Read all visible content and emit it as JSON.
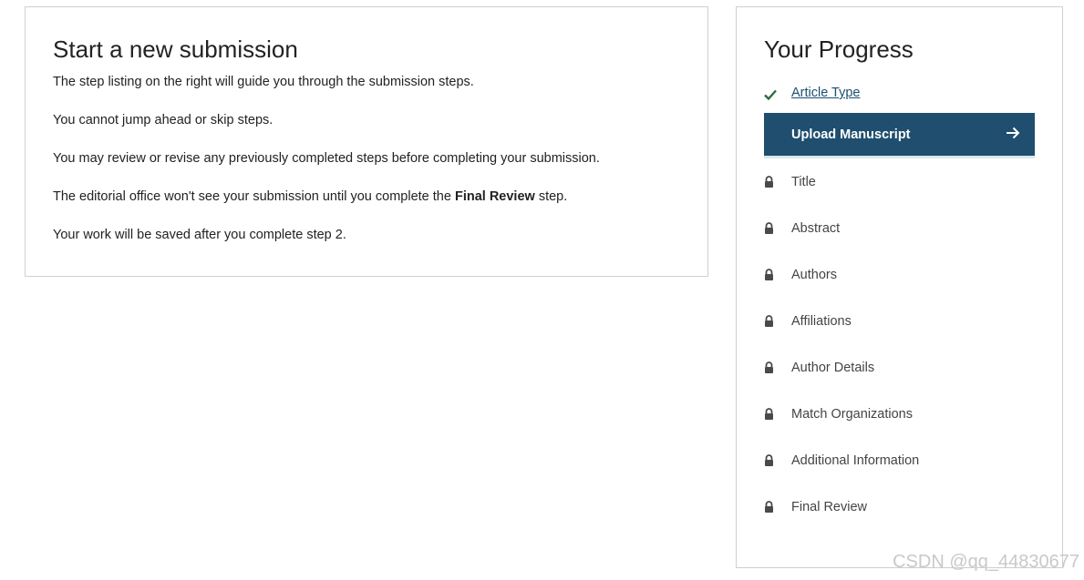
{
  "intro": {
    "title": "Start a new submission",
    "para1": "The step listing on the right will guide you through the submission steps.",
    "para2": "You cannot jump ahead or skip steps.",
    "para3": "You may review or revise any previously completed steps before completing your submission.",
    "para4_before": "The editorial office won't see your submission until you complete the ",
    "para4_bold": "Final Review",
    "para4_after": " step.",
    "para5": "Your work will be saved after you complete step 2."
  },
  "progress": {
    "title": "Your Progress",
    "completed_step": {
      "label": "Article Type",
      "icon": "checkmark-icon"
    },
    "current_step": {
      "label": "Upload Manuscript",
      "icon": "arrow-right-icon"
    },
    "locked_steps": [
      {
        "label": "Title"
      },
      {
        "label": "Abstract"
      },
      {
        "label": "Authors"
      },
      {
        "label": "Affiliations"
      },
      {
        "label": "Author Details"
      },
      {
        "label": "Match Organizations"
      },
      {
        "label": "Additional Information"
      },
      {
        "label": "Final Review"
      }
    ]
  },
  "watermark": "CSDN @qq_44830677",
  "colors": {
    "current_step_bg": "#1f4e6e",
    "check_green": "#2e6b3f",
    "link_blue": "#1b4f72",
    "lock_gray": "#4a4a4a"
  }
}
